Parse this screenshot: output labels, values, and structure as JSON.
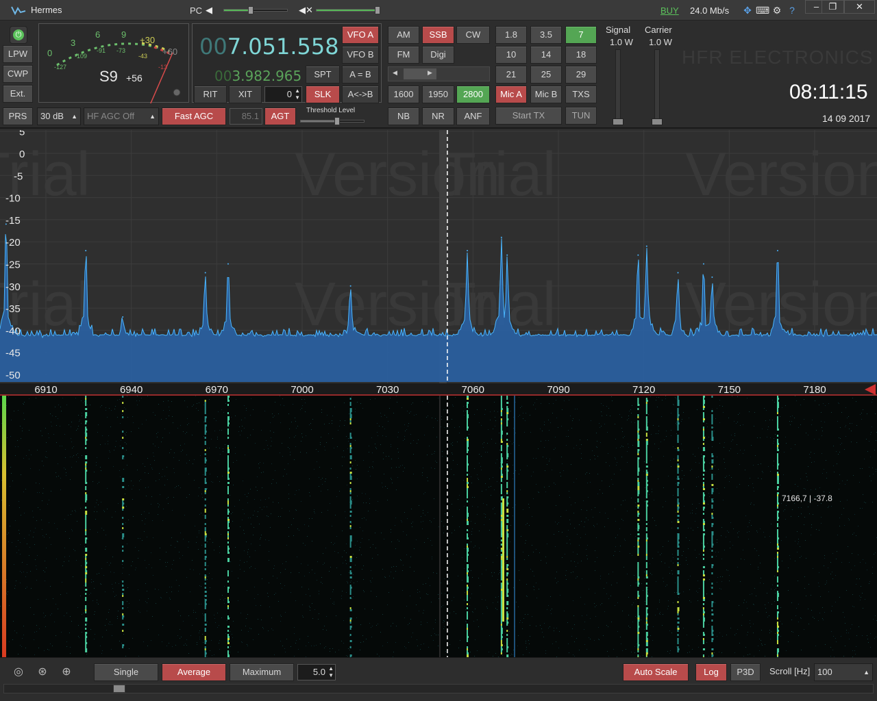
{
  "titlebar": {
    "app_title": "Hermes",
    "pc_label": "PC",
    "buy_label": "BUY",
    "data_rate": "24.0 Mb/s",
    "pc_level": 0.45,
    "volume_level": 1.0,
    "window_buttons": [
      "–",
      "❐",
      "✕"
    ]
  },
  "meter": {
    "scale_green": [
      "0",
      "3",
      "6",
      "9"
    ],
    "scale_yellow": [
      "+30"
    ],
    "scale_gray": [
      "+60"
    ],
    "scale_sub": [
      "-127",
      "-109",
      "-91",
      "-73",
      "-43",
      "-13"
    ],
    "s_reading": "S9",
    "db_reading": "+56"
  },
  "left_buttons": {
    "lpw": "LPW",
    "cwp": "CWP",
    "ext": "Ext.",
    "prs": "PRS"
  },
  "vfo": {
    "freq_a_dim": "00",
    "freq_a": "7.051.558",
    "freq_b_dim": "00",
    "freq_b": "3.982.965",
    "vfo_a": "VFO A",
    "vfo_b": "VFO B",
    "spt": "SPT",
    "a_eq_b": "A = B",
    "rit": "RIT",
    "xit": "XIT",
    "rit_value": "0",
    "slk": "SLK",
    "a_swap_b": "A<->B"
  },
  "agc": {
    "att": "30 dB",
    "agc_mode": "HF AGC Off",
    "fast_agc": "Fast AGC",
    "agc_value": "85.1",
    "agt": "AGT",
    "threshold_label": "Threshold Level",
    "threshold_level": 0.6
  },
  "modes": {
    "am": "AM",
    "ssb": "SSB",
    "cw": "CW",
    "fm": "FM",
    "digi": "Digi",
    "bw_1600": "1600",
    "bw_1950": "1950",
    "bw_2800": "2800",
    "nb": "NB",
    "nr": "NR",
    "anf": "ANF"
  },
  "bands": {
    "b1": "1.8",
    "b2": "3.5",
    "b3": "7",
    "b4": "10",
    "b5": "14",
    "b6": "18",
    "b7": "21",
    "b8": "25",
    "b9": "29",
    "mic_a": "Mic A",
    "mic_b": "Mic B",
    "txs": "TXS",
    "start_tx": "Start TX",
    "tun": "TUN"
  },
  "power": {
    "signal_label": "Signal",
    "signal_value": "1.0 W",
    "carrier_label": "Carrier",
    "carrier_value": "1.0 W"
  },
  "brand_watermark": "HFR ELECTRONICS",
  "clock": {
    "time": "08:11:15",
    "date": "14 09 2017"
  },
  "spectrum": {
    "y_ticks": [
      "5",
      "0",
      "-5",
      "-10",
      "-15",
      "-20",
      "-25",
      "-30",
      "-35",
      "-40",
      "-45",
      "-50"
    ],
    "x_ticks": [
      "6910",
      "6940",
      "6970",
      "7000",
      "7030",
      "7060",
      "7090",
      "7120",
      "7150",
      "7180"
    ],
    "watermark": "Trial Version",
    "cursor_readout": "7166,7 | -37.8",
    "colors": {
      "trace": "#4ab6ff",
      "fill": "#2a5f9e",
      "background": "#2f2f2f"
    }
  },
  "chart_data": {
    "type": "area",
    "xlabel": "",
    "ylabel": "",
    "xlim": [
      6895,
      7200
    ],
    "ylim": [
      -52,
      5
    ],
    "noise_floor": -42,
    "peaks": [
      {
        "x": 6896,
        "y": -16
      },
      {
        "x": 6924,
        "y": -22
      },
      {
        "x": 6937,
        "y": -37
      },
      {
        "x": 6966,
        "y": -27
      },
      {
        "x": 6974,
        "y": -25
      },
      {
        "x": 7017,
        "y": -30
      },
      {
        "x": 7058,
        "y": -22
      },
      {
        "x": 7070,
        "y": -19
      },
      {
        "x": 7072,
        "y": -23
      },
      {
        "x": 7118,
        "y": -23
      },
      {
        "x": 7121,
        "y": -21
      },
      {
        "x": 7132,
        "y": -27
      },
      {
        "x": 7141,
        "y": -25
      },
      {
        "x": 7144,
        "y": -28
      },
      {
        "x": 7167,
        "y": -22
      }
    ],
    "center_frequency": 7051
  },
  "bottom": {
    "single": "Single",
    "average": "Average",
    "maximum": "Maximum",
    "avg_value": "5.0",
    "auto_scale": "Auto Scale",
    "log": "Log",
    "p3d": "P3D",
    "scroll_label": "Scroll [Hz]",
    "scroll_value": "100"
  }
}
